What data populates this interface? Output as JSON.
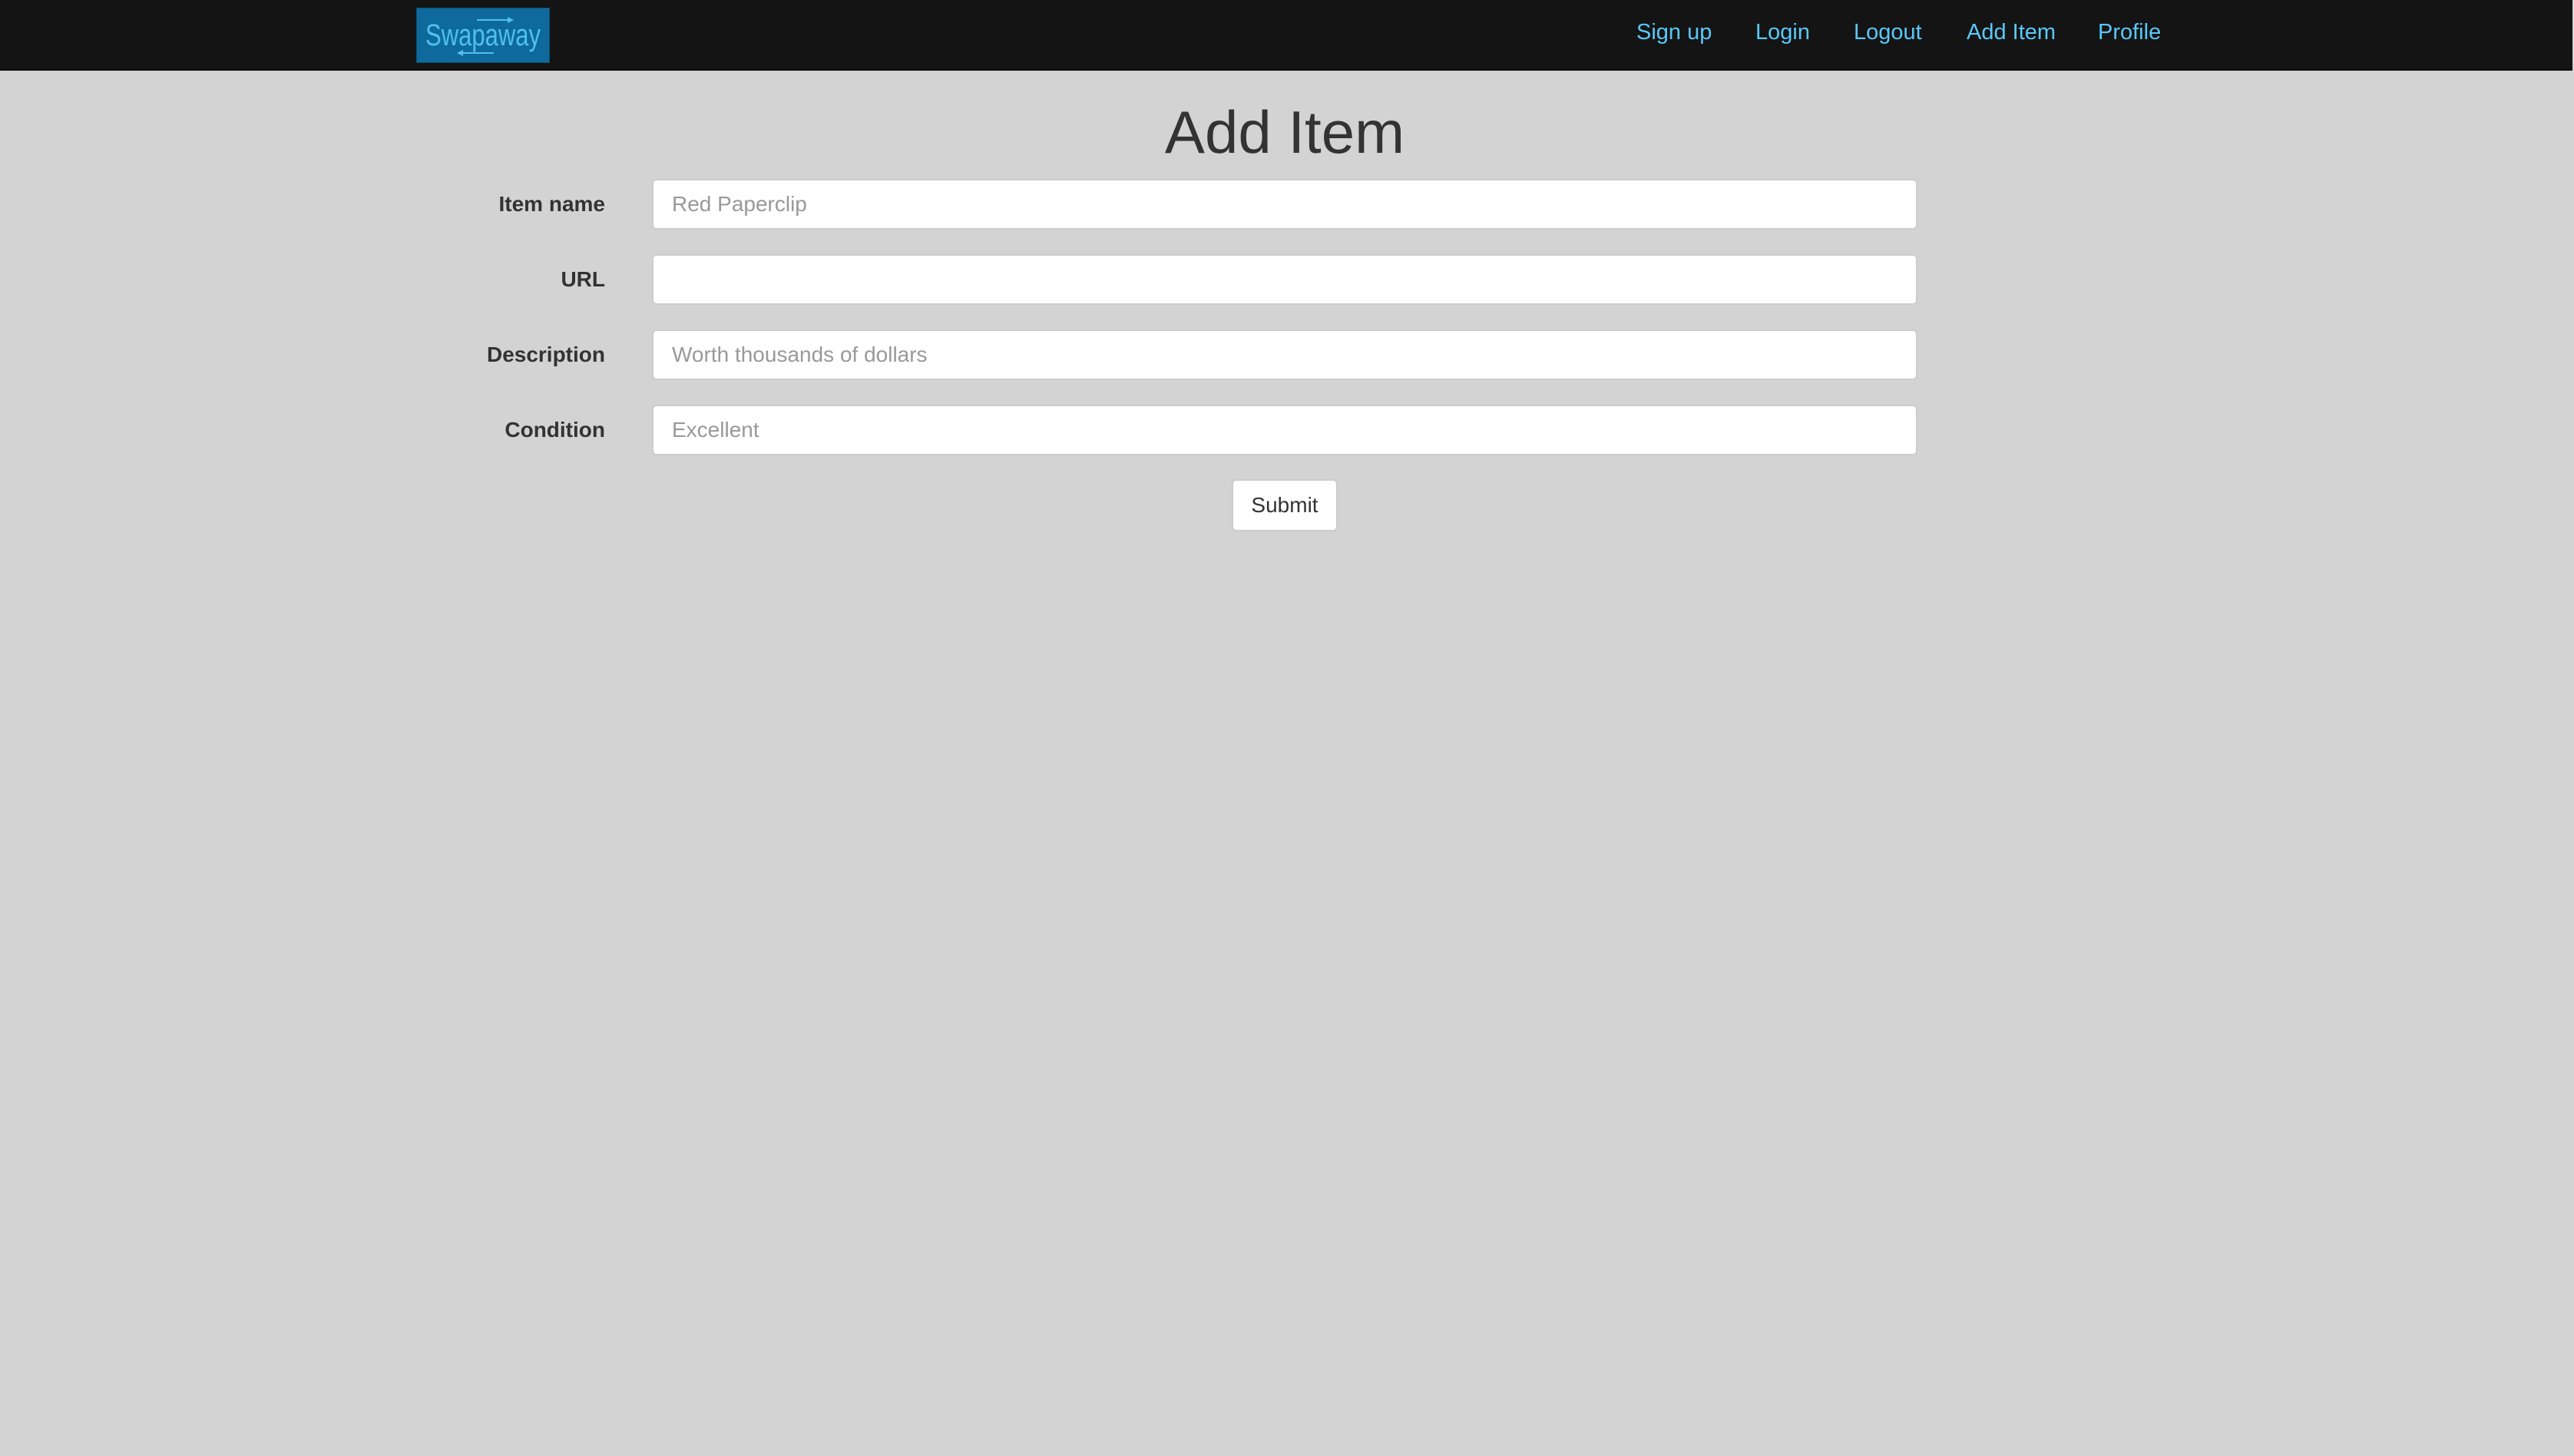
{
  "navbar": {
    "brand": {
      "text": "Swapaway",
      "color": "#0e6a9c",
      "text_color": "#4fc0f0"
    },
    "links": [
      {
        "label": "Sign up"
      },
      {
        "label": "Login"
      },
      {
        "label": "Logout"
      },
      {
        "label": "Add Item"
      },
      {
        "label": "Profile"
      }
    ],
    "link_color": "#5ac8fa",
    "background": "#141414"
  },
  "main": {
    "title": "Add Item",
    "form": {
      "fields": [
        {
          "label": "Item name",
          "value": "",
          "placeholder": "Red Paperclip"
        },
        {
          "label": "URL",
          "value": "",
          "placeholder": ""
        },
        {
          "label": "Description",
          "value": "",
          "placeholder": "Worth thousands of dollars"
        },
        {
          "label": "Condition",
          "value": "",
          "placeholder": "Excellent"
        }
      ],
      "submit_label": "Submit"
    },
    "background": "#d3d3d3"
  }
}
